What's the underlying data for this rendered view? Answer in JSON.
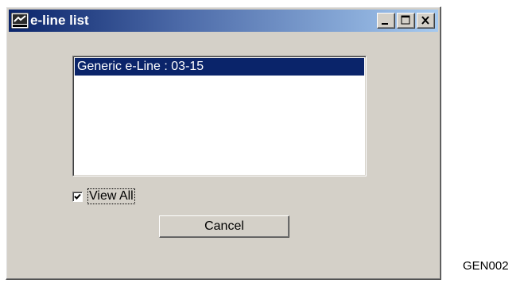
{
  "window": {
    "title": "e-line list",
    "icon": "app-icon",
    "controls": [
      "minimize-icon",
      "maximize-icon",
      "close-icon"
    ]
  },
  "list": {
    "items": [
      {
        "label": "Generic e-Line : 03-15",
        "selected": true
      }
    ]
  },
  "view_all": {
    "label": "View All",
    "checked": true
  },
  "cancel_button": {
    "label": "Cancel"
  },
  "figure_label": "GEN002",
  "colors": {
    "titlebar_start": "#0a246a",
    "selection": "#0a246a",
    "face": "#d4d0c8"
  }
}
